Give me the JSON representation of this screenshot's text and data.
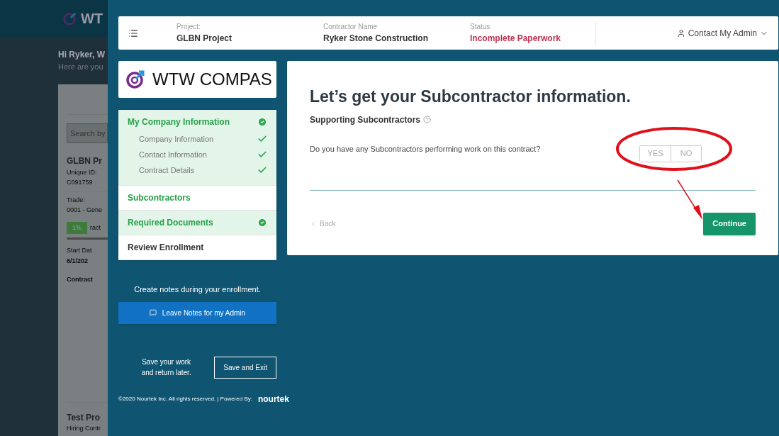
{
  "background_page": {
    "logo_text": "WT",
    "greeting": "Hi Ryker, W",
    "subtitle": "Here are you",
    "search_placeholder": "Search by",
    "project": {
      "name": "GLBN Pr",
      "id_label": "Unique ID:",
      "id": "C091759",
      "trade_label": "Trade:",
      "trade": "0001 - Gene",
      "progress_badge": "1%",
      "progress_suffix": "ract",
      "level": 0.01,
      "start_label": "Start Dat",
      "start": "6/1/202",
      "contract_label": "Contract"
    },
    "next_project": {
      "name": "Test Pro",
      "hiring_label": "Hiring Contr"
    }
  },
  "header": {
    "fields": [
      {
        "label": "Project:",
        "value": "GLBN Project",
        "kind": "plain"
      },
      {
        "label": "Contractor Name",
        "value": "Ryker Stone Construction",
        "kind": "plain"
      },
      {
        "label": "Status",
        "value": "Incomplete Paperwork",
        "kind": "alert"
      }
    ],
    "contact_button": "Contact My Admin"
  },
  "logo": {
    "text": "WTW COMPAS"
  },
  "steps": [
    {
      "label": "My Company Information",
      "completed": true,
      "selected": false,
      "children": [
        {
          "label": "Company Information",
          "completed": true
        },
        {
          "label": "Contact Information",
          "completed": true
        },
        {
          "label": "Contract Details",
          "completed": true
        }
      ]
    },
    {
      "label": "Subcontractors",
      "completed": false,
      "selected": true
    },
    {
      "label": "Required Documents",
      "completed": true,
      "selected": false
    },
    {
      "label": "Review Enrollment",
      "completed": false,
      "selected": false
    }
  ],
  "notes": {
    "text": "Create notes during your enrollment.",
    "button": "Leave Notes for my Admin"
  },
  "save": {
    "text_lines": [
      "Save your work",
      "and return later."
    ],
    "button": "Save and Exit"
  },
  "footer": {
    "copyright": "©2020 Nourtek Inc. All rights reserved. | Powered By:",
    "brand": "nourtek"
  },
  "form": {
    "title": "Let’s get your Subcontractor information.",
    "section": "Supporting Subcontractors",
    "question": "Do you have any Subcontractors performing work on this contract?",
    "options": [
      {
        "label": "YES",
        "selected": false
      },
      {
        "label": "NO",
        "selected": false
      }
    ],
    "back": "Back",
    "continue": "Continue"
  }
}
